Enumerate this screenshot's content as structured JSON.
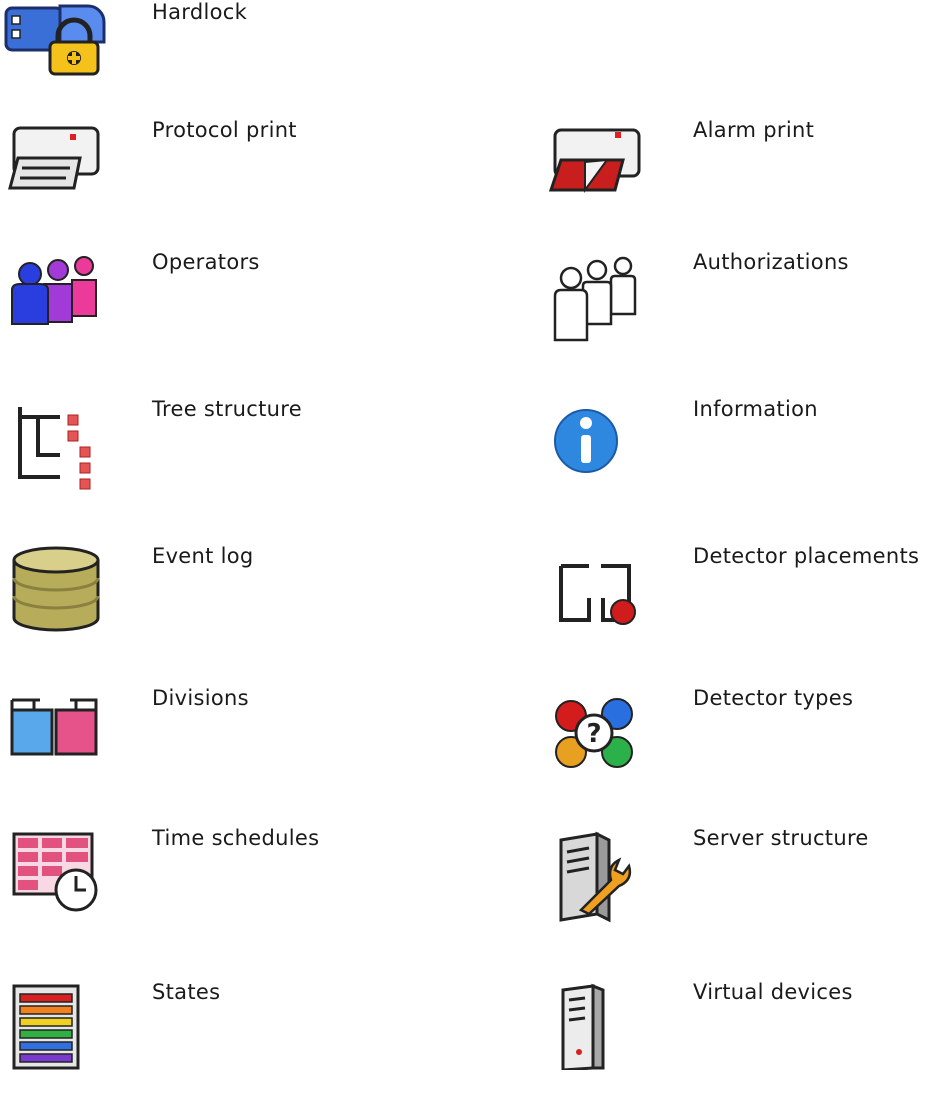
{
  "icon_legend": {
    "items": [
      {
        "id": "hardlock",
        "label": "Hardlock",
        "icon": "hardlock-icon"
      },
      {
        "id": "protocol-print",
        "label": "Protocol print",
        "icon": "printer-icon"
      },
      {
        "id": "alarm-print",
        "label": "Alarm print",
        "icon": "alarm-printer-icon"
      },
      {
        "id": "operators",
        "label": "Operators",
        "icon": "operators-icon"
      },
      {
        "id": "authorizations",
        "label": "Authorizations",
        "icon": "authorizations-icon"
      },
      {
        "id": "tree-structure",
        "label": "Tree structure",
        "icon": "tree-structure-icon"
      },
      {
        "id": "information",
        "label": "Information",
        "icon": "information-icon"
      },
      {
        "id": "event-log",
        "label": "Event log",
        "icon": "database-icon"
      },
      {
        "id": "detector-placements",
        "label": "Detector placements",
        "icon": "detector-placement-icon"
      },
      {
        "id": "divisions",
        "label": "Divisions",
        "icon": "divisions-icon"
      },
      {
        "id": "detector-types",
        "label": "Detector types",
        "icon": "detector-types-icon"
      },
      {
        "id": "time-schedules",
        "label": "Time schedules",
        "icon": "time-schedule-icon"
      },
      {
        "id": "server-structure",
        "label": "Server structure",
        "icon": "server-structure-icon"
      },
      {
        "id": "states",
        "label": "States",
        "icon": "states-icon"
      },
      {
        "id": "virtual-devices",
        "label": "Virtual devices",
        "icon": "virtual-device-icon"
      }
    ]
  }
}
